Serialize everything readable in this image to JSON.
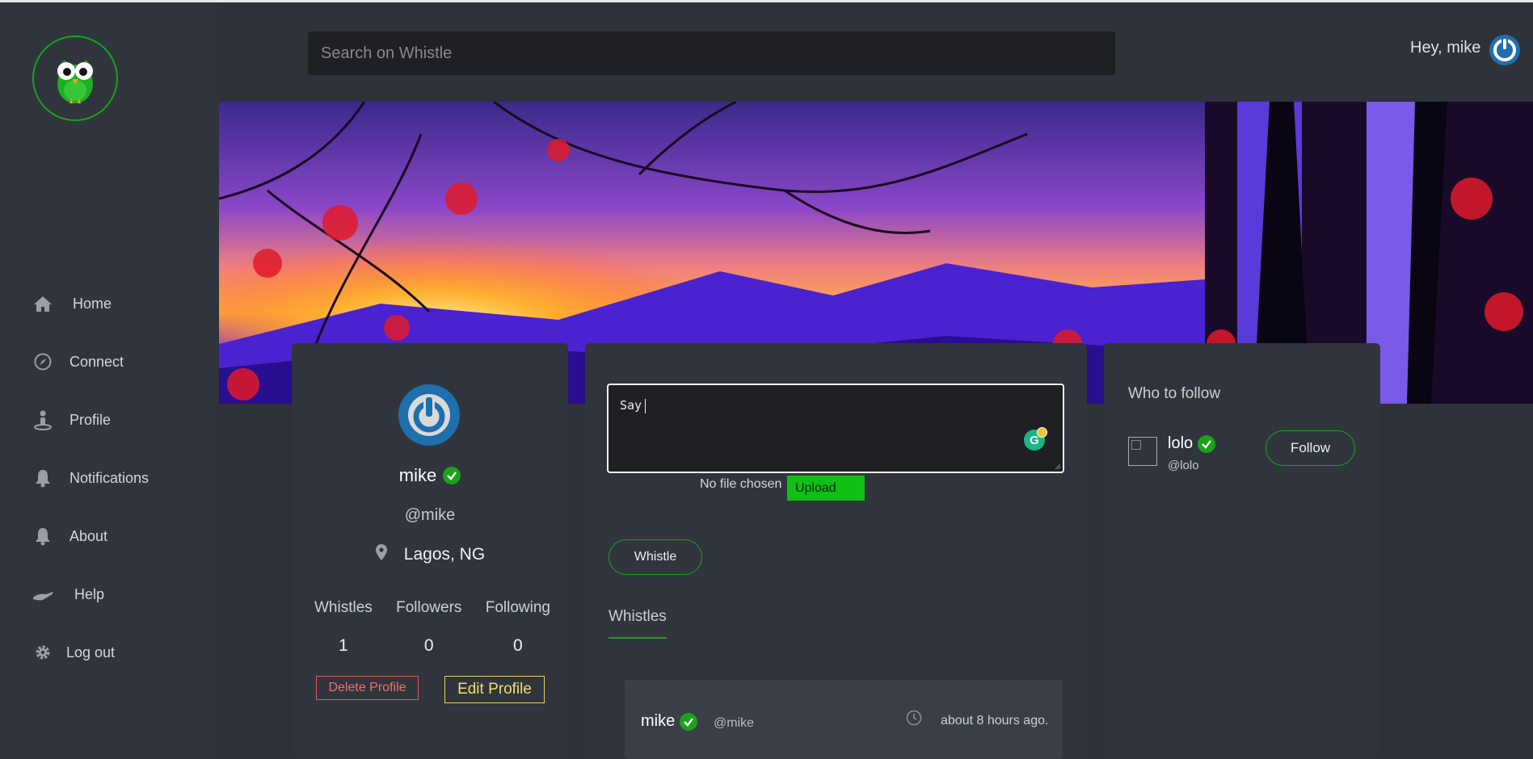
{
  "search": {
    "placeholder": "Search on Whistle"
  },
  "header": {
    "greeting": "Hey, mike"
  },
  "sidebar": {
    "items": [
      {
        "label": "Home",
        "icon": "home-icon"
      },
      {
        "label": "Connect",
        "icon": "compass-icon"
      },
      {
        "label": "Profile",
        "icon": "person-icon"
      },
      {
        "label": "Notifications",
        "icon": "bell-icon"
      },
      {
        "label": "About",
        "icon": "bell-icon"
      },
      {
        "label": "Help",
        "icon": "hand-icon"
      },
      {
        "label": "Log out",
        "icon": "gear-icon"
      }
    ]
  },
  "profile": {
    "name": "mike",
    "handle": "@mike",
    "location": "Lagos, NG",
    "stats": [
      {
        "label": "Whistles",
        "value": "1"
      },
      {
        "label": "Followers",
        "value": "0"
      },
      {
        "label": "Following",
        "value": "0"
      }
    ],
    "delete_label": "Delete Profile",
    "edit_label": "Edit Profile"
  },
  "composer": {
    "text": "Say",
    "file_status": "No file chosen",
    "upload_label": "Upload",
    "grammarly_glyph": "G",
    "submit_label": "Whistle"
  },
  "feed": {
    "tab_label": "Whistles",
    "posts": [
      {
        "name": "mike",
        "handle": "@mike",
        "time": "about 8 hours ago."
      }
    ]
  },
  "who_to_follow": {
    "title": "Who to follow",
    "users": [
      {
        "name": "lolo",
        "handle": "@lolo",
        "button": "Follow"
      }
    ]
  },
  "colors": {
    "accent_green": "#17a417",
    "upload_green": "#0fbf14",
    "delete_red": "#e05a5a",
    "edit_yellow": "#e6d25c",
    "avatar_blue": "#1e6fae",
    "background": "#2e323a"
  }
}
